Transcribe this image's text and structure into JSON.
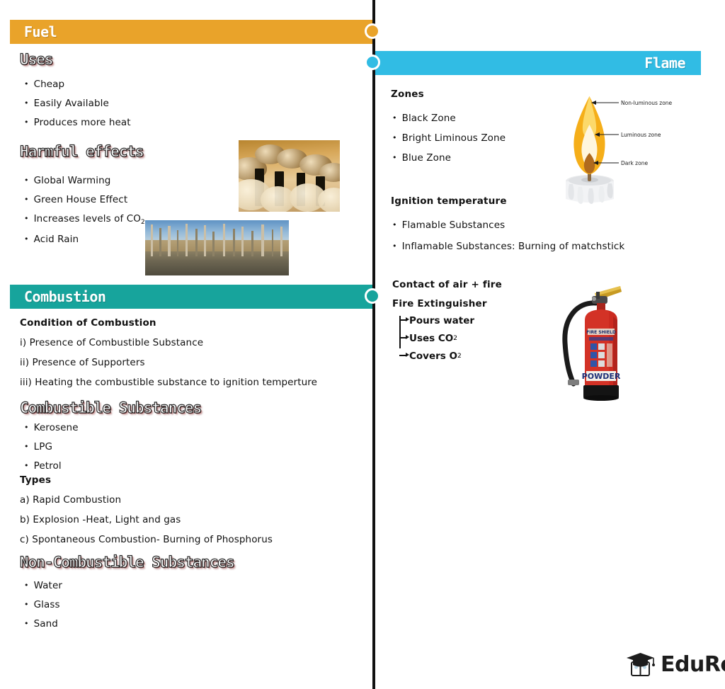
{
  "theme": {
    "fuel_bar_color": "#E9A32A",
    "flame_bar_color": "#31BCE4",
    "combustion_bar_color": "#17A49C",
    "line_color": "#111111",
    "heading_shadow_color": "#7D3B3B",
    "page_background": "#FFFFFF"
  },
  "sections": {
    "fuel": {
      "bar_title": "Fuel",
      "uses": {
        "heading": "Uses",
        "items": [
          "Cheap",
          "Easily Available",
          "Produces more heat"
        ]
      },
      "harmful": {
        "heading": "Harmful effects",
        "items": [
          "Global Warming",
          "Green House Effect",
          "Increases levels of CO",
          "Acid Rain"
        ],
        "co2_subscript": "2"
      },
      "images": {
        "smokestack_alt": "factory-smokestacks-emitting-smoke",
        "forest_alt": "dead-forest-damaged-by-acid-rain"
      }
    },
    "flame": {
      "bar_title": "Flame",
      "zones": {
        "heading": "Zones",
        "items": [
          "Black Zone",
          "Bright Liminous Zone",
          "Blue Zone"
        ]
      },
      "candle_labels": [
        "Non-luminous zone",
        "Luminous zone",
        "Dark zone"
      ],
      "ignition": {
        "heading": "Ignition temperature",
        "items": [
          "Flamable Substances",
          "Inflamable Substances: Burning of matchstick"
        ]
      },
      "contact_line": "Contact of air + fire",
      "extinguisher": {
        "heading": "Fire Extinguisher",
        "branches": [
          "Pours water",
          "Uses CO",
          "Covers O"
        ],
        "branch_subscripts": [
          "",
          "2",
          "2"
        ],
        "label_brand": "FIRE SHIELD",
        "label_type": "POWDER"
      }
    },
    "combustion": {
      "bar_title": "Combustion",
      "condition": {
        "heading": "Condition of Combustion",
        "items": [
          "i) Presence of Combustible Substance",
          "ii) Presence of Supporters",
          "iii) Heating the combustible substance to ignition temperture"
        ]
      },
      "combustible": {
        "heading": "Combustible Substances",
        "items": [
          "Kerosene",
          "LPG",
          "Petrol"
        ]
      },
      "types": {
        "heading": "Types",
        "items": [
          "a) Rapid Combustion",
          "b) Explosion -Heat, Light and gas",
          "c) Spontaneous Combustion- Burning of Phosphorus"
        ]
      },
      "non_combustible": {
        "heading": "Non-Combustible Substances",
        "items": [
          "Water",
          "Glass",
          "Sand"
        ]
      }
    }
  },
  "footer": {
    "brand": "EduRev",
    "logo_icon": "graduation-cap-book-icon"
  }
}
